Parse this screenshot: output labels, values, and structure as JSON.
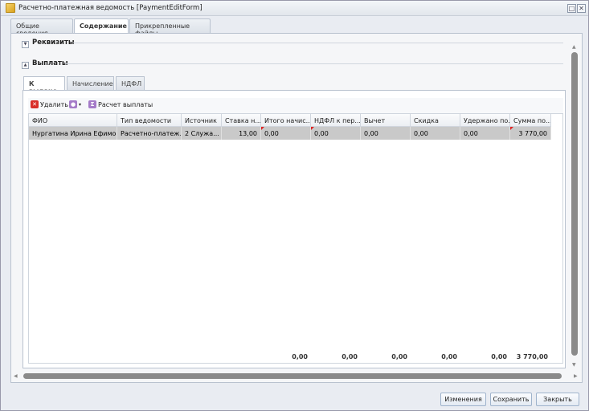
{
  "window": {
    "title": "Расчетно-платежная ведомость [PaymentEditForm]"
  },
  "tabs": [
    "Общие сведения",
    "Содержание",
    "Прикрепленные файлы"
  ],
  "sections": {
    "requisites": "Реквизиты",
    "payments": "Выплаты"
  },
  "subtabs": [
    "К выдаче",
    "Начисление",
    "НДФЛ"
  ],
  "toolbar": {
    "delete": "Удалить",
    "calc": "Расчет выплаты"
  },
  "grid": {
    "columns": [
      "ФИО",
      "Тип ведомости",
      "Источник",
      "Ставка н...",
      "Итого начис...",
      "НДФЛ к пер...",
      "Вычет",
      "Скидка",
      "Удержано по...",
      "Сумма по..."
    ],
    "rows": [
      [
        "Нургатина Ирина Ефимов...",
        "Расчетно-платеж...",
        "2 Служа...",
        "13,00",
        "0,00",
        "0,00",
        "0,00",
        "0,00",
        "0,00",
        "3 770,00"
      ]
    ],
    "totals": [
      "",
      "",
      "",
      "",
      "0,00",
      "0,00",
      "0,00",
      "0,00",
      "0,00",
      "3 770,00"
    ]
  },
  "buttons": {
    "changes": "Изменения",
    "save": "Сохранить",
    "close": "Закрыть"
  }
}
